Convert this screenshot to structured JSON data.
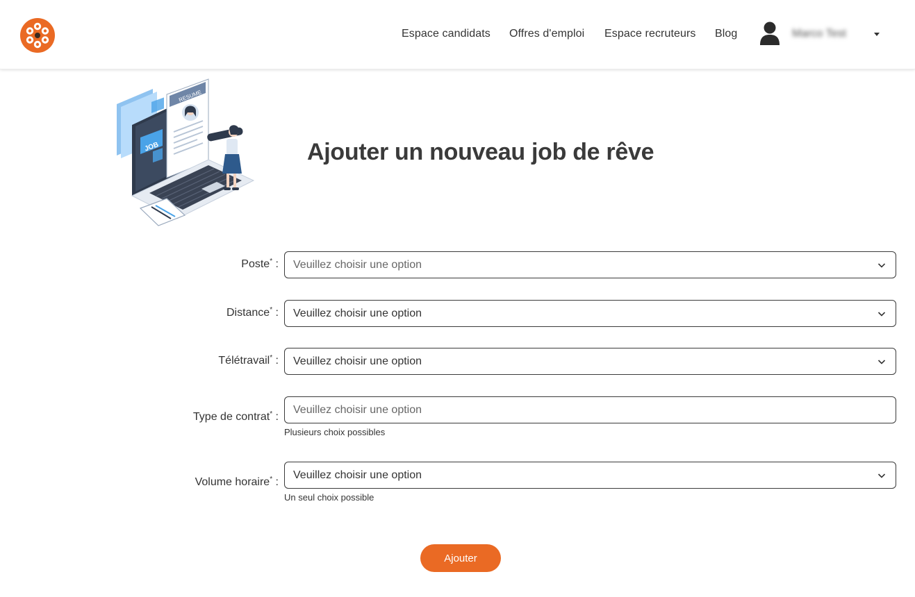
{
  "header": {
    "nav": [
      {
        "label": "Espace candidats"
      },
      {
        "label": "Offres d'emploi"
      },
      {
        "label": "Espace recruteurs"
      },
      {
        "label": "Blog"
      }
    ],
    "user": {
      "name": "Marco Test",
      "icon": "user-icon",
      "menu_icon": "caret-down-icon"
    },
    "logo_icon": "flower-logo-icon"
  },
  "illustration": {
    "badge_job": "JOB",
    "badge_resume": "RESUME"
  },
  "page": {
    "title": "Ajouter un nouveau job de rêve"
  },
  "form": {
    "fields": [
      {
        "label": "Poste",
        "required_mark": "*",
        "suffix": " :",
        "value": "Veuillez choisir une option",
        "placeholder": true,
        "help": ""
      },
      {
        "label": "Distance",
        "required_mark": "*",
        "suffix": " :",
        "value": "Veuillez choisir une option",
        "placeholder": false,
        "help": ""
      },
      {
        "label": "Télétravail",
        "required_mark": "*",
        "suffix": " :",
        "value": "Veuillez choisir une option",
        "placeholder": false,
        "help": ""
      },
      {
        "label": "Type de contrat",
        "required_mark": "*",
        "suffix": " :",
        "value": "Veuillez choisir une option",
        "placeholder": true,
        "help": "Plusieurs choix possibles"
      },
      {
        "label": "Volume horaire",
        "required_mark": "*",
        "suffix": " :",
        "value": "Veuillez choisir une option",
        "placeholder": false,
        "help": "Un seul choix possible"
      }
    ],
    "submit_label": "Ajouter"
  },
  "colors": {
    "accent": "#ea6a24",
    "text": "#333333",
    "border": "#3a3a3a"
  }
}
